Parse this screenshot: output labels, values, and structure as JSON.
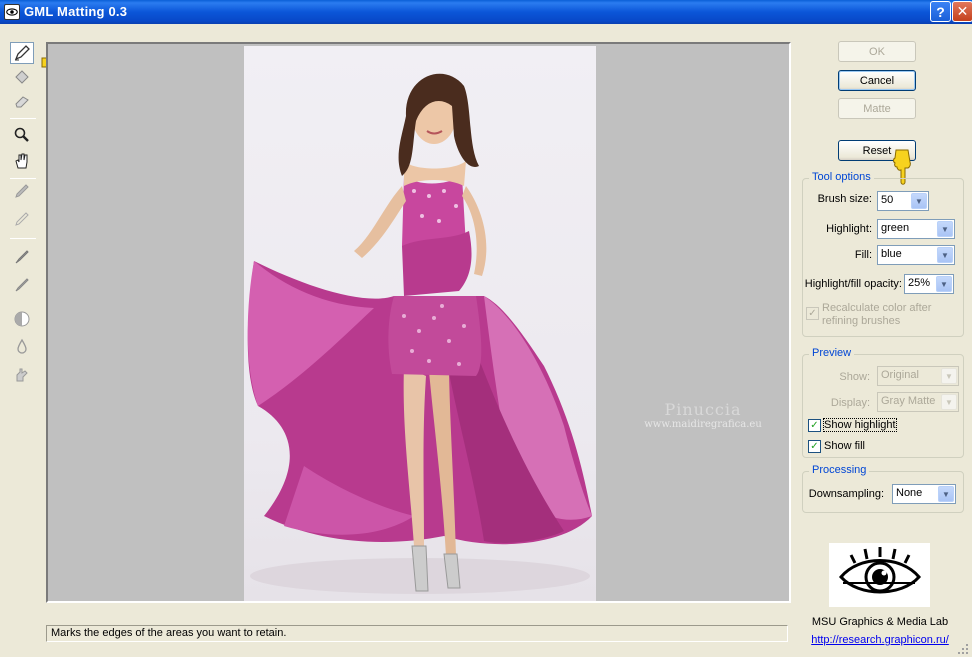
{
  "window": {
    "title": "GML Matting 0.3",
    "help_glyph": "?",
    "close_glyph": "✕"
  },
  "toolbar": {
    "tools": [
      {
        "name": "marker-pen-icon",
        "active": true
      },
      {
        "name": "paint-bucket-icon"
      },
      {
        "name": "eraser-icon"
      },
      {
        "name": "magnifier-icon"
      },
      {
        "name": "hand-icon"
      },
      {
        "name": "pencil-icon"
      },
      {
        "name": "pencil-faded-icon"
      },
      {
        "name": "brush-icon"
      },
      {
        "name": "brush-small-icon"
      },
      {
        "name": "half-circle-icon"
      },
      {
        "name": "drop-icon"
      },
      {
        "name": "smudge-icon"
      }
    ]
  },
  "canvas": {
    "watermark_line1": "Pinuccia",
    "watermark_line2": "www.maidiregrafica.eu"
  },
  "status": {
    "text": "Marks the edges of the areas you want to retain."
  },
  "buttons": {
    "ok": "OK",
    "cancel": "Cancel",
    "matte": "Matte",
    "reset": "Reset"
  },
  "tool_options": {
    "title": "Tool options",
    "brush_size_label": "Brush size:",
    "brush_size_value": "50",
    "highlight_label": "Highlight:",
    "highlight_value": "green",
    "fill_label": "Fill:",
    "fill_value": "blue",
    "opacity_label": "Highlight/fill opacity:",
    "opacity_value": "25%",
    "recalc_label_line1": "Recalculate color after",
    "recalc_label_line2": "refining brushes",
    "recalc_checked": true
  },
  "preview": {
    "title": "Preview",
    "show_label": "Show:",
    "show_value": "Original",
    "display_label": "Display:",
    "display_value": "Gray Matte",
    "show_highlight_label": "Show highlight",
    "show_highlight_checked": true,
    "show_fill_label": "Show fill",
    "show_fill_checked": true
  },
  "processing": {
    "title": "Processing",
    "downsampling_label": "Downsampling:",
    "downsampling_value": "None"
  },
  "lab": {
    "name": "MSU Graphics & Media Lab",
    "url": "http://research.graphicon.ru/"
  },
  "colors": {
    "accent": "#0046d5",
    "titlebar": "#0b56d8",
    "canvas_bg": "#c0c0c0",
    "dress": "#c8479e"
  }
}
